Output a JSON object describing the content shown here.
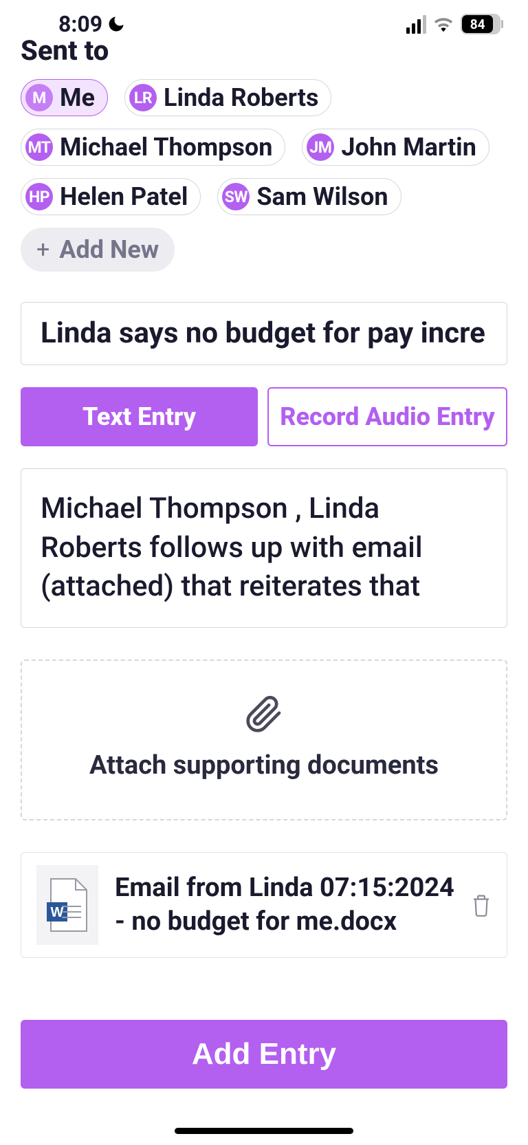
{
  "status": {
    "time": "8:09",
    "battery": "84"
  },
  "sent_to_label": "Sent to",
  "chips": [
    {
      "initials": "M",
      "name": "Me",
      "selected": true
    },
    {
      "initials": "LR",
      "name": "Linda Roberts",
      "selected": false
    },
    {
      "initials": "MT",
      "name": "Michael Thompson",
      "selected": false
    },
    {
      "initials": "JM",
      "name": "John Martin",
      "selected": false
    },
    {
      "initials": "HP",
      "name": "Helen Patel",
      "selected": false
    },
    {
      "initials": "SW",
      "name": "Sam Wilson",
      "selected": false
    }
  ],
  "add_new_label": "Add New",
  "title_text": "Linda says no budget for pay incre",
  "tabs": {
    "text_entry": "Text Entry",
    "record_audio": "Record Audio Entry"
  },
  "body_text": "Michael Thompson , Linda Roberts follows up with email (attached) that reiterates that",
  "attach_label": "Attach supporting documents",
  "attachment": {
    "filename": "Email from Linda 07:15:2024 - no budget for me.docx"
  },
  "add_entry_label": "Add Entry"
}
